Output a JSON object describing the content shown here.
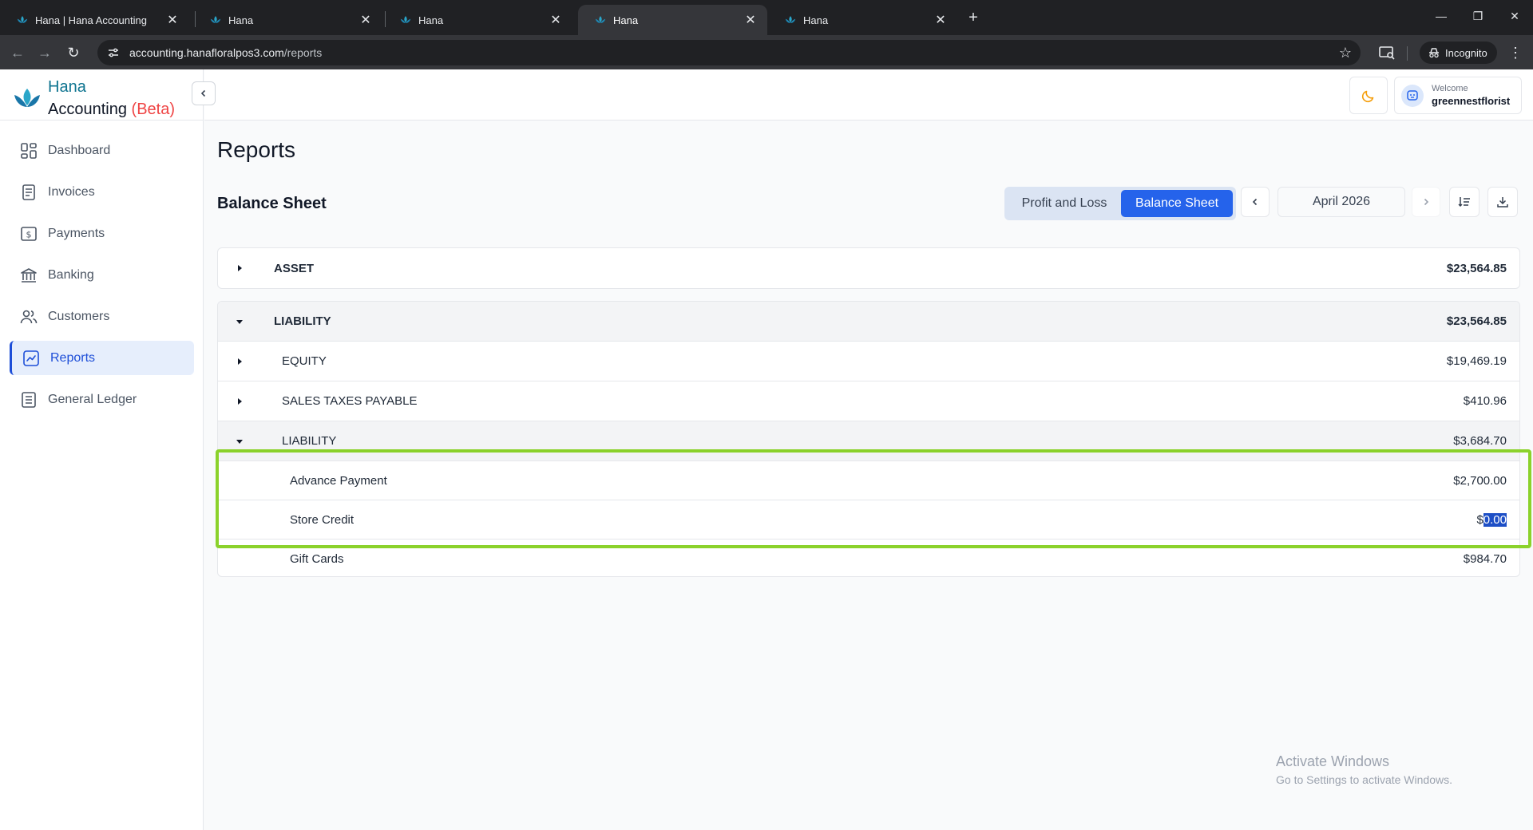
{
  "browser": {
    "tabs": [
      {
        "title": "Hana | Hana Accounting"
      },
      {
        "title": "Hana"
      },
      {
        "title": "Hana"
      },
      {
        "title": "Hana"
      },
      {
        "title": "Hana"
      }
    ],
    "url_host": "accounting.hanafloralpos3.com",
    "url_path": "/reports",
    "incognito_label": "Incognito"
  },
  "brand": {
    "name": "Hana",
    "subtitle": "Accounting",
    "beta": "(Beta)"
  },
  "sidebar": {
    "items": [
      {
        "label": "Dashboard",
        "icon": "dashboard-icon"
      },
      {
        "label": "Invoices",
        "icon": "invoice-icon"
      },
      {
        "label": "Payments",
        "icon": "payment-icon"
      },
      {
        "label": "Banking",
        "icon": "bank-icon"
      },
      {
        "label": "Customers",
        "icon": "customers-icon"
      },
      {
        "label": "Reports",
        "icon": "reports-icon",
        "active": true
      },
      {
        "label": "General Ledger",
        "icon": "ledger-icon"
      }
    ]
  },
  "user": {
    "welcome": "Welcome",
    "name": "greennestflorist"
  },
  "page": {
    "title": "Reports",
    "section": "Balance Sheet",
    "toggle": {
      "profit_loss": "Profit and Loss",
      "balance_sheet": "Balance Sheet",
      "selected": "Balance Sheet"
    },
    "month": "April 2026"
  },
  "report": {
    "asset": {
      "label": "ASSET",
      "amount": "$23,564.85"
    },
    "liability": {
      "label": "LIABILITY",
      "amount": "$23,564.85"
    },
    "equity": {
      "label": "EQUITY",
      "amount": "$19,469.19"
    },
    "sales_taxes": {
      "label": "SALES TAXES PAYABLE",
      "amount": "$410.96"
    },
    "liability_sub": {
      "label": "LIABILITY",
      "amount": "$3,684.70"
    },
    "advance_payment": {
      "label": "Advance Payment",
      "amount": "$2,700.00"
    },
    "store_credit": {
      "label": "Store Credit",
      "amount_prefix": "$",
      "amount_selected": "0.00"
    },
    "gift_cards": {
      "label": "Gift Cards",
      "amount": "$984.70"
    }
  },
  "watermark": {
    "line1": "Activate Windows",
    "line2": "Go to Settings to activate Windows."
  },
  "colors": {
    "primary": "#2563eb",
    "brand_teal": "#0e7490",
    "beta_red": "#ef4444",
    "highlight": "#8bd22b"
  }
}
